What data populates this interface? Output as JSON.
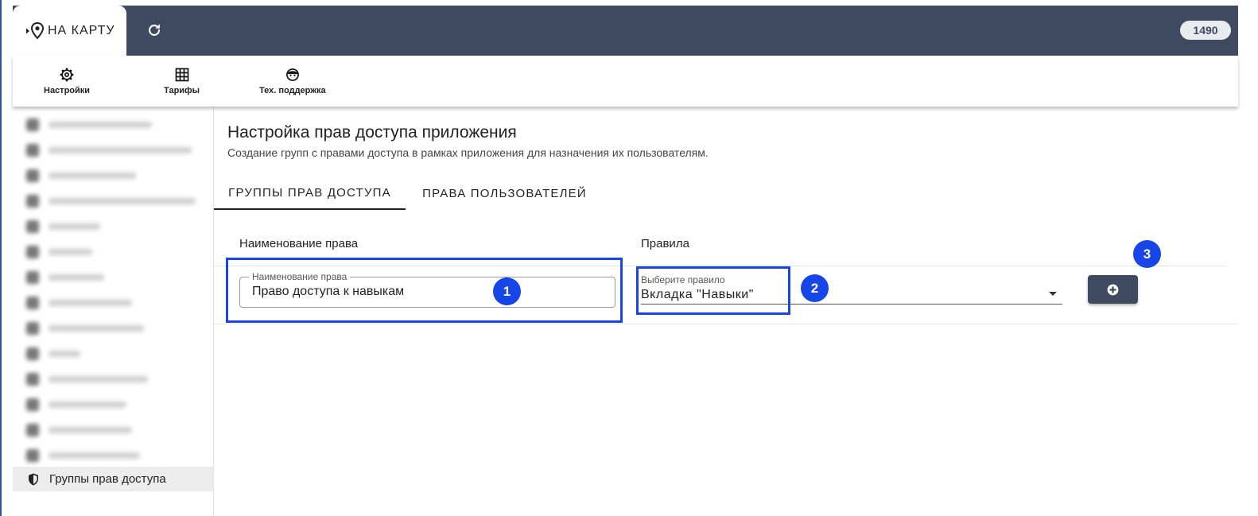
{
  "header": {
    "logo_text": "НА КАРТУ",
    "counter": "1490",
    "refresh_icon": "refresh-icon"
  },
  "subnav": [
    {
      "label": "Настройки",
      "icon": "gear-icon"
    },
    {
      "label": "Тарифы",
      "icon": "table-icon"
    },
    {
      "label": "Тех. поддержка",
      "icon": "support-icon"
    }
  ],
  "sidebar": {
    "active_label": "Группы прав доступа"
  },
  "page": {
    "title": "Настройка прав доступа приложения",
    "subtitle": "Создание групп с правами доступа в рамках приложения для назначения их пользователям."
  },
  "tabs": [
    {
      "label": "ГРУППЫ ПРАВ ДОСТУПА",
      "active": true
    },
    {
      "label": "ПРАВА ПОЛЬЗОВАТЕЛЕЙ",
      "active": false
    }
  ],
  "form": {
    "col_name_header": "Наименование права",
    "col_rules_header": "Правила",
    "name_legend": "Наименование права",
    "name_value": "Право доступа к навыкам",
    "rule_label": "Выберите правило",
    "rule_value": "Вкладка \"Навыки\""
  },
  "annotations": [
    "1",
    "2",
    "3"
  ],
  "colors": {
    "topbar": "#3d4a60",
    "highlight": "#1746e8"
  }
}
